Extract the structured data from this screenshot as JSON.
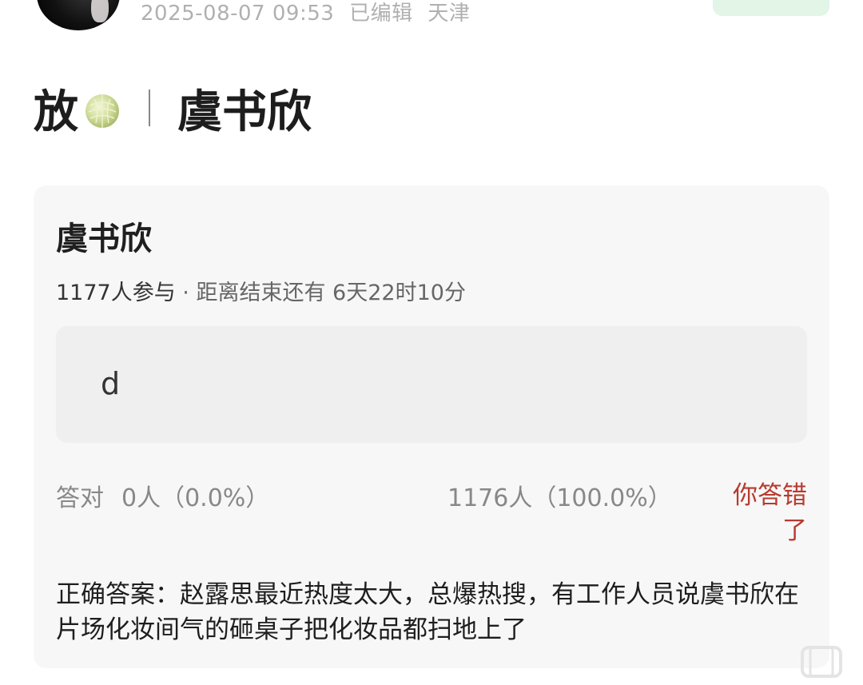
{
  "post": {
    "timestamp": "2025-08-07 09:53",
    "edited_label": "已编辑",
    "location": "天津",
    "title_prefix": "放",
    "title_name": "虞书欣"
  },
  "icons": {
    "melon": "melon-icon",
    "corner": "hollow-shape-icon"
  },
  "quiz": {
    "title": "虞书欣",
    "participants": "1177人参与",
    "separator": " · ",
    "countdown": "距离结束还有 6天22时10分",
    "option_text": "d",
    "correct_label": "答对",
    "correct_stats": "0人（0.0%）",
    "wrong_stats": "1176人（100.0%）",
    "wrong_label": "你答错了",
    "answer_text": "正确答案：赵露思最近热度太大，总爆热搜，有工作人员说虞书欣在片场化妆间气的砸桌子把化妆品都扫地上了"
  },
  "colors": {
    "accent_wrong": "#b83a2e",
    "follow_green": "#e2f5e6",
    "card_bg": "#f7f7f7"
  }
}
